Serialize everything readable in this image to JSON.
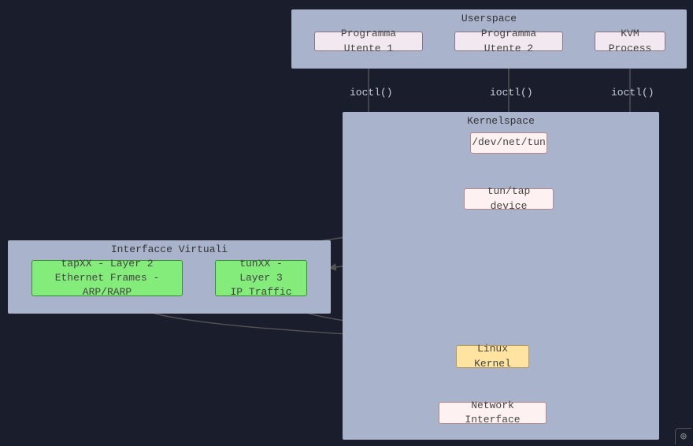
{
  "userspace": {
    "title": "Userspace",
    "nodes": {
      "prog1": "Programma Utente 1",
      "prog2": "Programma Utente 2",
      "kvm": "KVM Process"
    }
  },
  "kernelspace": {
    "title": "Kernelspace",
    "nodes": {
      "devnettun": "/dev/net/tun",
      "tuntapdev": "tun/tap device",
      "linuxkernel": "Linux Kernel",
      "netif": "Network Interface"
    }
  },
  "virtual_interfaces": {
    "title": "Interfacce Virtuali",
    "nodes": {
      "tap_line1": "tapXX - Layer 2",
      "tap_line2": "Ethernet Frames - ARP/RARP",
      "tun_line1": "tunXX - Layer 3",
      "tun_line2": "IP Traffic"
    }
  },
  "edge_labels": {
    "ioctl1": "ioctl()",
    "ioctl2": "ioctl()",
    "ioctl3": "ioctl()"
  },
  "zoom_icon": "⊕"
}
